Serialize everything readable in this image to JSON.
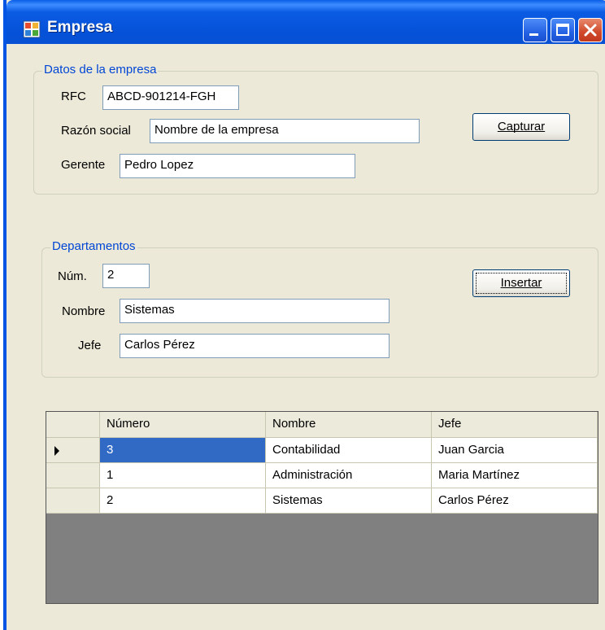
{
  "window": {
    "title": "Empresa"
  },
  "empresa": {
    "legend": "Datos de la empresa",
    "rfc_label": "RFC",
    "rfc_value": "ABCD-901214-FGH",
    "razon_label": "Razón social",
    "razon_value": "Nombre de la empresa",
    "gerente_label": "Gerente",
    "gerente_value": "Pedro Lopez",
    "capturar_label": "Capturar"
  },
  "departamentos": {
    "legend": "Departamentos",
    "num_label": "Núm.",
    "num_value": "2",
    "nombre_label": "Nombre",
    "nombre_value": "Sistemas",
    "jefe_label": "Jefe",
    "jefe_value": "Carlos Pérez",
    "insertar_label": "Insertar"
  },
  "grid": {
    "columns": [
      "Número",
      "Nombre",
      "Jefe"
    ],
    "rows": [
      [
        "3",
        "Contabilidad",
        "Juan Garcia"
      ],
      [
        "1",
        "Administración",
        "Maria Martínez"
      ],
      [
        "2",
        "Sistemas",
        "Carlos Pérez"
      ]
    ],
    "current_row": 0,
    "selected_cell": [
      0,
      0
    ]
  },
  "colors": {
    "title_bar": "#0552d8",
    "legend_text": "#0046d5",
    "selection": "#316ac5",
    "grid_background": "#808080"
  }
}
